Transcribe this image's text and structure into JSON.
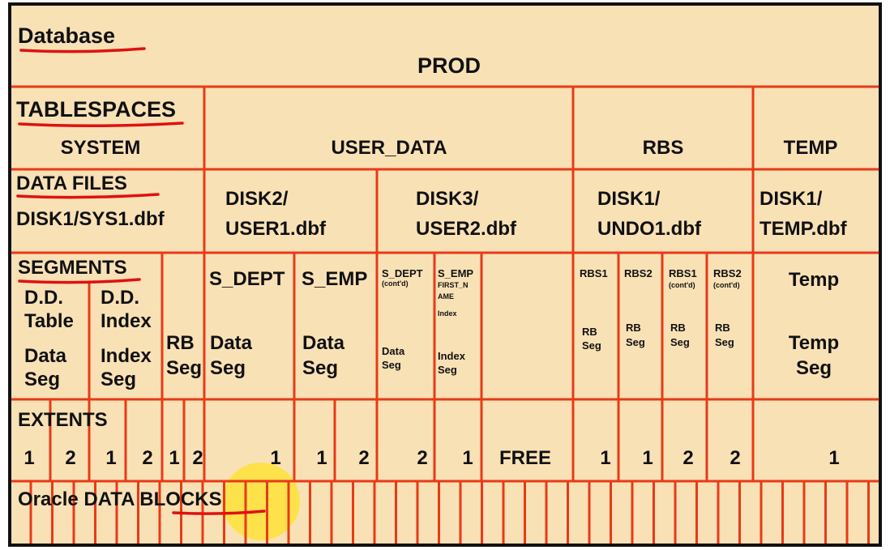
{
  "colors": {
    "background": "#f9e1b6",
    "gridline": "#e83a17",
    "border": "#111111",
    "underline": "#e01010",
    "highlight": "#ffe23a"
  },
  "database": {
    "label": "Database",
    "name": "PROD"
  },
  "tablespaces": {
    "label": "TABLESPACES",
    "items": [
      "SYSTEM",
      "USER_DATA",
      "RBS",
      "TEMP"
    ]
  },
  "datafiles": {
    "label": "DATA FILES",
    "system": "DISK1/SYS1.dbf",
    "user1": [
      "DISK2/",
      "USER1.dbf"
    ],
    "user2": [
      "DISK3/",
      "USER2.dbf"
    ],
    "undo": [
      "DISK1/",
      "UNDO1.dbf"
    ],
    "temp": [
      "DISK1/",
      "TEMP.dbf"
    ]
  },
  "segments": {
    "label": "SEGMENTS",
    "dd_table": {
      "name": [
        "D.D.",
        "Table"
      ],
      "type": [
        "Data",
        "Seg"
      ]
    },
    "dd_index": {
      "name": [
        "D.D.",
        "Index"
      ],
      "type": [
        "Index",
        "Seg"
      ]
    },
    "rb": [
      "RB",
      "Seg"
    ],
    "s_dept": {
      "name": "S_DEPT",
      "type": [
        "Data",
        "Seg"
      ]
    },
    "s_emp": {
      "name": "S_EMP",
      "type": [
        "Data",
        "Seg"
      ]
    },
    "s_dept2": {
      "name": "S_DEPT",
      "note": "(cont'd)",
      "type": [
        "Data",
        "Seg"
      ]
    },
    "s_emp2": {
      "name": "S_EMP",
      "note": [
        "FIRST_N",
        "AME"
      ],
      "sub": "Index",
      "type": [
        "Index",
        "Seg"
      ]
    },
    "rbs": [
      {
        "name": "RBS1",
        "note": "",
        "type": [
          "RB",
          "Seg"
        ]
      },
      {
        "name": "RBS2",
        "note": "",
        "type": [
          "RB",
          "Seg"
        ]
      },
      {
        "name": "RBS1",
        "note": "(cont'd)",
        "type": [
          "RB",
          "Seg"
        ]
      },
      {
        "name": "RBS2",
        "note": "(cont'd)",
        "type": [
          "RB",
          "Seg"
        ]
      }
    ],
    "temp": {
      "name": "Temp",
      "type": [
        "Temp",
        "Seg"
      ]
    }
  },
  "extents": {
    "label": "EXTENTS",
    "values": [
      "1",
      "2",
      "1",
      "2",
      "1",
      "2",
      "1",
      "1",
      "2",
      "2",
      "1",
      "FREE",
      "1",
      "1",
      "2",
      "2",
      "1"
    ]
  },
  "blocks": {
    "label_prefix": "Oracle ",
    "label_main": "DATA BLOCKS"
  }
}
